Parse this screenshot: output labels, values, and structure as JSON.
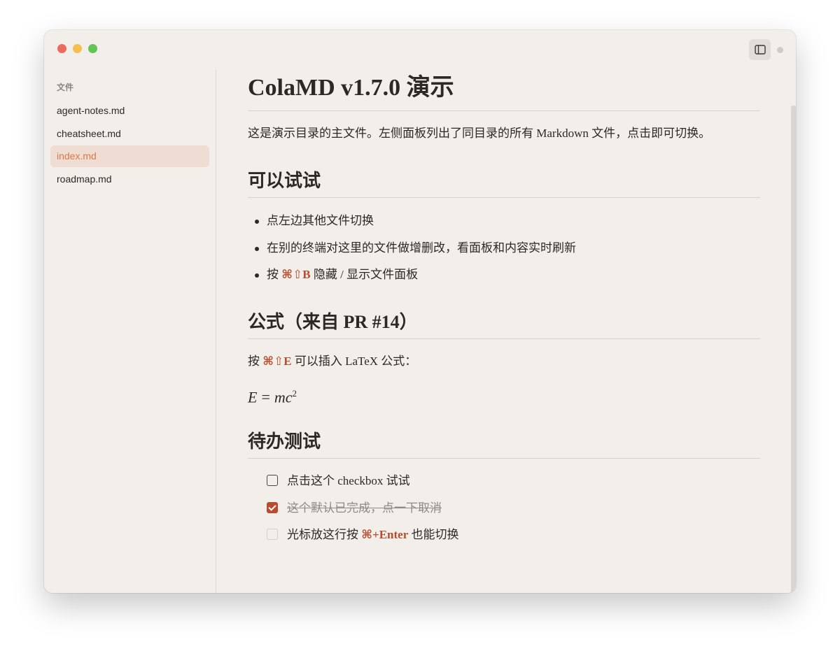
{
  "window": {
    "traffic_colors": [
      "#ec6a5e",
      "#f4bf4f",
      "#61c554"
    ],
    "toggle_icon": "sidebar-toggle-icon"
  },
  "sidebar": {
    "title": "文件",
    "files": [
      {
        "label": "agent-notes.md",
        "active": false
      },
      {
        "label": "cheatsheet.md",
        "active": false
      },
      {
        "label": "index.md",
        "active": true
      },
      {
        "label": "roadmap.md",
        "active": false
      }
    ]
  },
  "doc": {
    "title": "ColaMD v1.7.0 演示",
    "intro": "这是演示目录的主文件。左侧面板列出了同目录的所有 Markdown 文件，点击即可切换。",
    "section1": {
      "heading": "可以试试",
      "items": [
        {
          "text": "点左边其他文件切换"
        },
        {
          "text": "在别的终端对这里的文件做增删改，看面板和内容实时刷新"
        },
        {
          "prefix": "按 ",
          "kbd": "⌘⇧B",
          "suffix": " 隐藏 / 显示文件面板"
        }
      ]
    },
    "section2": {
      "heading": "公式（来自 PR #14）",
      "para_prefix": "按 ",
      "para_kbd": "⌘⇧E",
      "para_suffix": " 可以插入 LaTeX 公式：",
      "formula_lhs": "E",
      "formula_op": "=",
      "formula_rhs": "mc",
      "formula_exp": "2"
    },
    "section3": {
      "heading": "待办测试",
      "tasks": [
        {
          "text": "点击这个 checkbox 试试",
          "checked": false
        },
        {
          "text": "这个默认已完成，点一下取消",
          "checked": true
        },
        {
          "prefix": "光标放这行按 ",
          "kbd": "⌘+Enter",
          "suffix": " 也能切换",
          "checked": false
        }
      ]
    },
    "accent_color": "#b94b2e",
    "active_file_color": "#d97a48"
  }
}
